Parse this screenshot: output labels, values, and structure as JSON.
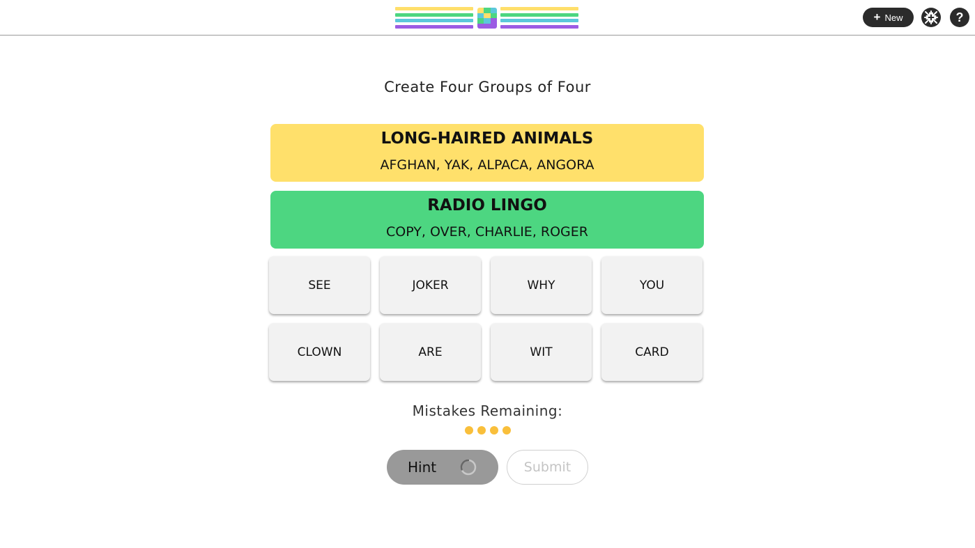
{
  "header": {
    "logo_colors": [
      "#ffdf6b",
      "#4dd681",
      "#5bc8db",
      "#9b5ce3"
    ],
    "new_label": "New",
    "new_icon": "plus-icon",
    "shrink_icon": "shrink-icon",
    "help_label": "?",
    "help_icon": "help-icon"
  },
  "title": "Create Four Groups of Four",
  "solved_groups": [
    {
      "title": "LONG-HAIRED ANIMALS",
      "words": "AFGHAN, YAK, ALPACA, ANGORA",
      "color": "#ffe06b"
    },
    {
      "title": "RADIO LINGO",
      "words": "COPY, OVER, CHARLIE, ROGER",
      "color": "#4dd681"
    }
  ],
  "tiles": [
    {
      "label": "SEE"
    },
    {
      "label": "JOKER"
    },
    {
      "label": "WHY"
    },
    {
      "label": "YOU"
    },
    {
      "label": "CLOWN"
    },
    {
      "label": "ARE"
    },
    {
      "label": "WIT"
    },
    {
      "label": "CARD"
    }
  ],
  "mistakes": {
    "label": "Mistakes Remaining:",
    "remaining": 4,
    "dot_color": "#f9bf3b"
  },
  "actions": {
    "hint_label": "Hint",
    "hint_loading": true,
    "submit_label": "Submit",
    "submit_enabled": false
  }
}
